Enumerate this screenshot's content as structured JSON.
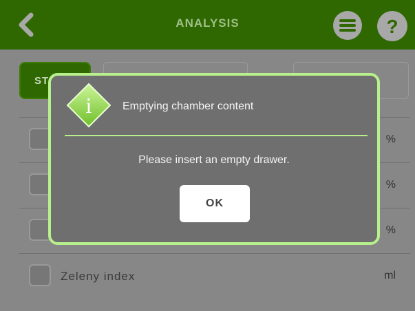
{
  "header": {
    "title": "ANALYSIS",
    "back_icon": "chevron-left-icon",
    "menu_icon": "menu-icon",
    "help_icon": "help-icon",
    "bg_color": "#2f6800"
  },
  "background_screen": {
    "start_button_label": "ST",
    "rows": [
      {
        "unit": "%"
      },
      {
        "unit": "%"
      },
      {
        "unit": "%"
      },
      {
        "label": "Zeleny index",
        "unit": "ml"
      }
    ]
  },
  "dialog": {
    "icon": "info-icon",
    "title": "Emptying chamber content",
    "message": "Please insert an empty drawer.",
    "ok_label": "OK",
    "accent_color": "#b8f08c"
  }
}
